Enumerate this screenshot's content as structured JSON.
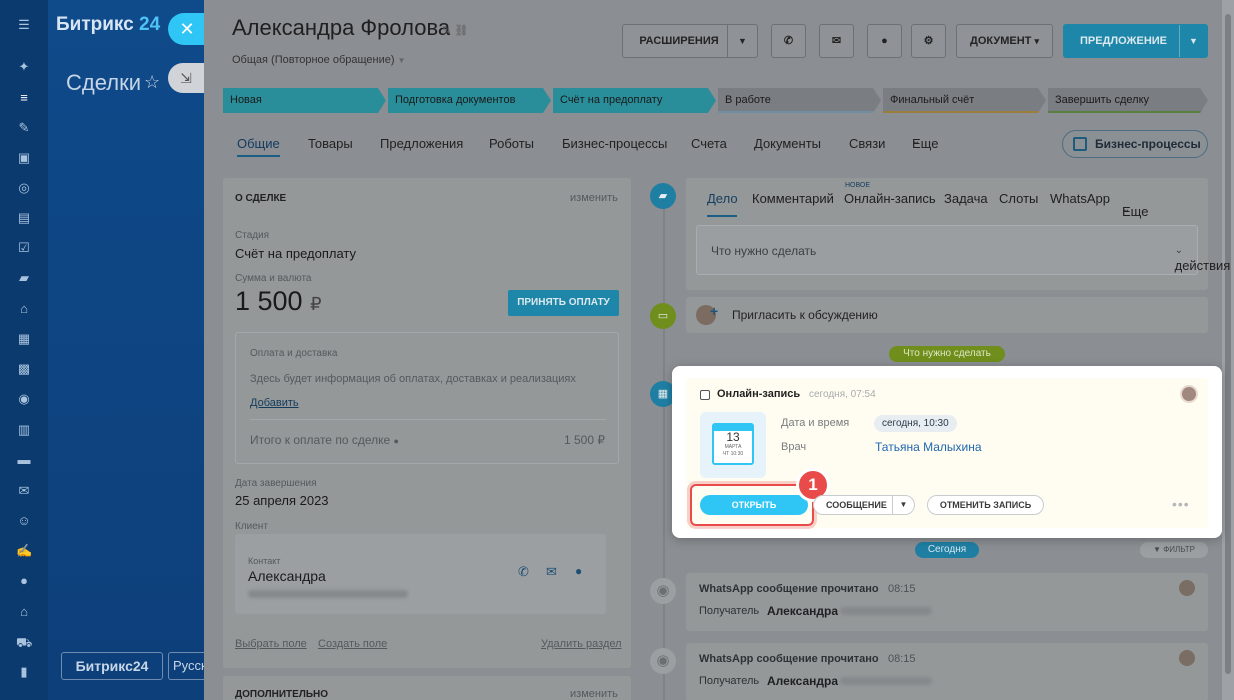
{
  "sidebar": {
    "icons": [
      "menu-icon",
      "puzzle-icon",
      "filter-icon",
      "task-icon",
      "contact-card-icon",
      "group-icon",
      "invoice-icon",
      "checklist-icon",
      "chat-icon",
      "robot-icon",
      "calendar-icon",
      "calendar-check-icon",
      "target-icon",
      "document-icon",
      "inbox-icon",
      "mail-icon",
      "users-icon",
      "sign-icon",
      "circle-icon",
      "bank-icon",
      "cart-icon",
      "chart-icon"
    ],
    "logo_main": "Битрикс",
    "logo_num": "24",
    "page_title": "Сделки",
    "bottom_logo": "Битрикс24",
    "bottom_lang": "Русский"
  },
  "header": {
    "name": "Александра Фролова",
    "subtitle": "Общая (Повторное обращение)",
    "extensions": "РАСШИРЕНИЯ",
    "document": "ДОКУМЕНТ",
    "offer": "ПРЕДЛОЖЕНИЕ"
  },
  "stages": [
    "Новая",
    "Подготовка документов",
    "Счёт на предоплату",
    "В работе",
    "Финальный счёт",
    "Завершить сделку"
  ],
  "tabs": [
    "Общие",
    "Товары",
    "Предложения",
    "Роботы",
    "Бизнес-процессы",
    "Счета",
    "Документы",
    "Связи",
    "Еще"
  ],
  "bp_button": "Бизнес-процессы",
  "deal": {
    "section_title": "О СДЕЛКЕ",
    "edit": "изменить",
    "stage_label": "Стадия",
    "stage_value": "Счёт на предоплату",
    "amount_label": "Сумма и валюта",
    "amount": "1 500",
    "currency": "₽",
    "accept_payment": "ПРИНЯТЬ ОПЛАТУ",
    "payment_title": "Оплата и доставка",
    "payment_text": "Здесь будет информация об оплатах, доставках и реализациях",
    "add": "Добавить",
    "total_label": "Итого к оплате по сделке",
    "total_value": "1 500 ₽",
    "close_date_label": "Дата завершения",
    "close_date": "25 апреля 2023",
    "client_label": "Клиент",
    "contact_label": "Контакт",
    "contact_name": "Александра",
    "choose_field": "Выбрать поле",
    "create_field": "Создать поле",
    "delete_section": "Удалить раздел",
    "additional": "ДОПОЛНИТЕЛЬНО"
  },
  "timeline": {
    "tabs": [
      "Дело",
      "Комментарий",
      "Онлайн-запись",
      "Задача",
      "Слоты",
      "WhatsApp",
      "Еще"
    ],
    "new_badge": "НОВОЕ",
    "todo_placeholder": "Что нужно сделать",
    "actions": "действия",
    "invite": "Пригласить к обсуждению",
    "todo_pill": "Что нужно сделать",
    "today_pill": "Сегодня",
    "filter": "ФИЛЬТР",
    "wa1_title": "WhatsApp сообщение прочитано",
    "wa1_time": "08:15",
    "wa_recipient_label": "Получатель",
    "wa_recipient": "Александра",
    "wa2_title": "WhatsApp сообщение прочитано",
    "wa2_time": "08:15"
  },
  "booking": {
    "title": "Онлайн-запись",
    "time": "сегодня, 07:54",
    "date_label": "Дата и время",
    "date_value": "сегодня, 10:30",
    "doctor_label": "Врач",
    "doctor_value": "Татьяна Малыхина",
    "cal_day": "13",
    "cal_month": "МАРТА",
    "cal_time": "ЧТ 10:30",
    "open": "ОТКРЫТЬ",
    "message": "СООБЩЕНИЕ",
    "cancel": "ОТМЕНИТЬ ЗАПИСЬ",
    "step_number": "1"
  },
  "colors": {
    "accent": "#2fc6f6",
    "highlight": "#e94b4b",
    "stage_active": "#2a8e9a"
  }
}
